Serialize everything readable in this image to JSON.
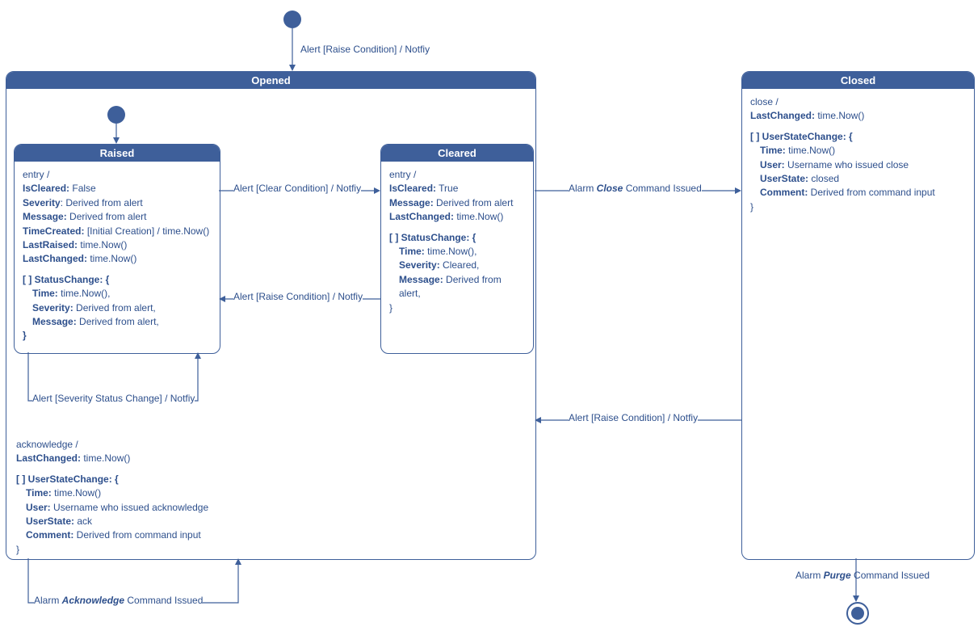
{
  "top_transition": "Alert [Raise Condition] / Notfiy",
  "opened": {
    "title": "Opened",
    "ack_block": {
      "line1": "acknowledge /",
      "lastchanged_k": "LastChanged:",
      "lastchanged_v": " time.Now()",
      "usc_header": "[ ] UserStateChange: {",
      "time_k": "Time:",
      "time_v": " time.Now()",
      "user_k": "User:",
      "user_v": " Username who issued acknowledge",
      "userstate_k": "UserState:",
      "userstate_v": " ack",
      "comment_k": "Comment:",
      "comment_v": " Derived from command input",
      "close_brace": "}"
    }
  },
  "raised": {
    "title": "Raised",
    "entry": "entry /",
    "iscleared_k": "IsCleared:",
    "iscleared_v": " False",
    "severity_k": "Severity",
    "severity_v": ": Derived from alert",
    "message_k": "Message:",
    "message_v": " Derived from alert",
    "timecreated_k": "TimeCreated:",
    "timecreated_v": " [Initial Creation] / time.Now()",
    "lastraised_k": "LastRaised:",
    "lastraised_v": " time.Now()",
    "lastchanged_k": "LastChanged:",
    "lastchanged_v": " time.Now()",
    "sc_header": "[ ] StatusChange: {",
    "sc_time_k": "Time:",
    "sc_time_v": " time.Now(),",
    "sc_sev_k": "Severity:",
    "sc_sev_v": " Derived from alert,",
    "sc_msg_k": "Message:",
    "sc_msg_v": " Derived from alert,",
    "sc_close": "}"
  },
  "cleared": {
    "title": "Cleared",
    "entry": "entry /",
    "iscleared_k": "IsCleared:",
    "iscleared_v": " True",
    "message_k": "Message:",
    "message_v": " Derived from alert",
    "lastchanged_k": "LastChanged:",
    "lastchanged_v": " time.Now()",
    "sc_header": "[ ] StatusChange: {",
    "sc_time_k": "Time:",
    "sc_time_v": " time.Now(),",
    "sc_sev_k": "Severity:",
    "sc_sev_v": " Cleared,",
    "sc_msg_k": "Message:",
    "sc_msg_v": " Derived from alert,",
    "sc_close": "}"
  },
  "closed": {
    "title": "Closed",
    "line1": "close /",
    "lastchanged_k": "LastChanged:",
    "lastchanged_v": " time.Now()",
    "usc_header": "[ ] UserStateChange: {",
    "time_k": "Time:",
    "time_v": " time.Now()",
    "user_k": "User:",
    "user_v": " Username who issued close",
    "userstate_k": "UserState:",
    "userstate_v": " closed",
    "comment_k": "Comment:",
    "comment_v": " Derived from command input",
    "close_brace": "}"
  },
  "transitions": {
    "raised_to_cleared": "Alert [Clear Condition] / Notfiy",
    "cleared_to_raised": "Alert [Raise Condition] / Notfiy",
    "raised_self": "Alert [Severity Status Change] / Notfiy",
    "opened_to_closed_pre": "Alarm ",
    "opened_to_closed_em": "Close",
    "opened_to_closed_post": " Command Issued",
    "closed_to_opened": "Alert [Raise Condition] / Notfiy",
    "ack_self_pre": "Alarm ",
    "ack_self_em": "Acknowledge",
    "ack_self_post": " Command Issued",
    "purge_pre": "Alarm ",
    "purge_em": "Purge",
    "purge_post": " Command Issued"
  }
}
